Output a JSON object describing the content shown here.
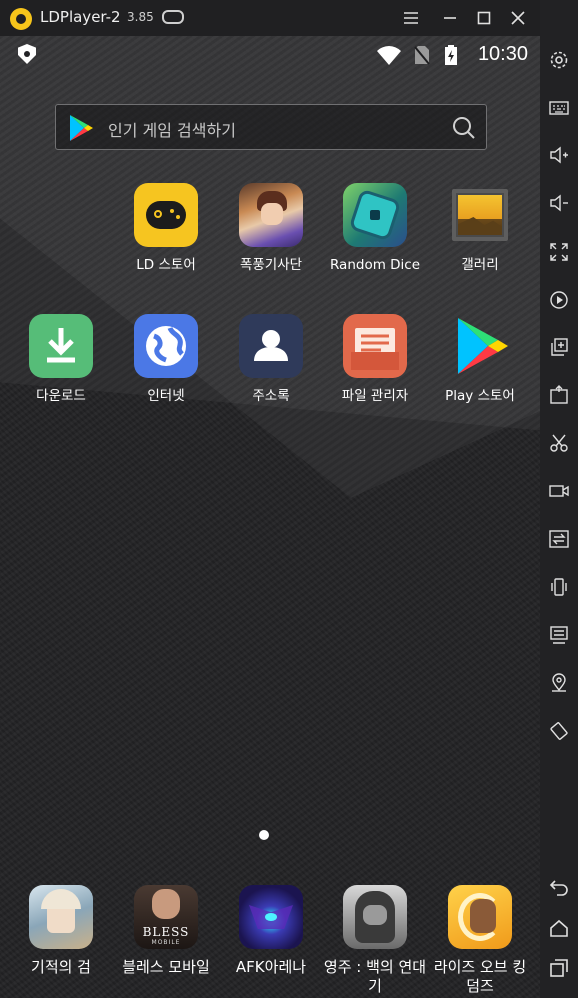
{
  "window": {
    "title": "LDPlayer-2",
    "version": "3.85"
  },
  "status_bar": {
    "time": "10:30"
  },
  "search": {
    "placeholder": "인기 게임 검색하기"
  },
  "apps": [
    {
      "label": "LD 스토어",
      "icon": "ld-store-icon"
    },
    {
      "label": "폭풍기사단",
      "icon": "game-knight-icon"
    },
    {
      "label": "Random Dice",
      "icon": "random-dice-icon"
    },
    {
      "label": "갤러리",
      "icon": "gallery-icon"
    },
    {
      "label": "다운로드",
      "icon": "download-icon"
    },
    {
      "label": "인터넷",
      "icon": "internet-icon"
    },
    {
      "label": "주소록",
      "icon": "contacts-icon"
    },
    {
      "label": "파일 관리자",
      "icon": "file-manager-icon"
    },
    {
      "label": "Play 스토어",
      "icon": "play-store-icon"
    }
  ],
  "dock": [
    {
      "label": "기적의 검",
      "icon": "miracle-sword-icon"
    },
    {
      "label": "블레스 모바일",
      "icon": "bless-mobile-icon",
      "icon_text": "BLESS",
      "icon_subtext": "MOBILE"
    },
    {
      "label": "AFK아레나",
      "icon": "afk-arena-icon"
    },
    {
      "label": "영주 : 백의 연대기",
      "icon": "lord-chronicle-icon"
    },
    {
      "label": "라이즈 오브 킹덤즈",
      "icon": "rise-of-kingdoms-icon"
    }
  ],
  "sidebar": [
    "settings-icon",
    "keyboard-icon",
    "volume-up-icon",
    "volume-down-icon",
    "fullscreen-icon",
    "record-icon",
    "multi-instance-icon",
    "apk-install-icon",
    "screenshot-scissors-icon",
    "video-record-icon",
    "sync-icon",
    "shake-icon",
    "desktop-icon",
    "location-icon",
    "rotate-icon",
    "back-icon",
    "home-icon",
    "recents-icon"
  ],
  "colors": {
    "accent": "#f7c51b",
    "titlebar": "#202022",
    "screen": "#232325"
  }
}
